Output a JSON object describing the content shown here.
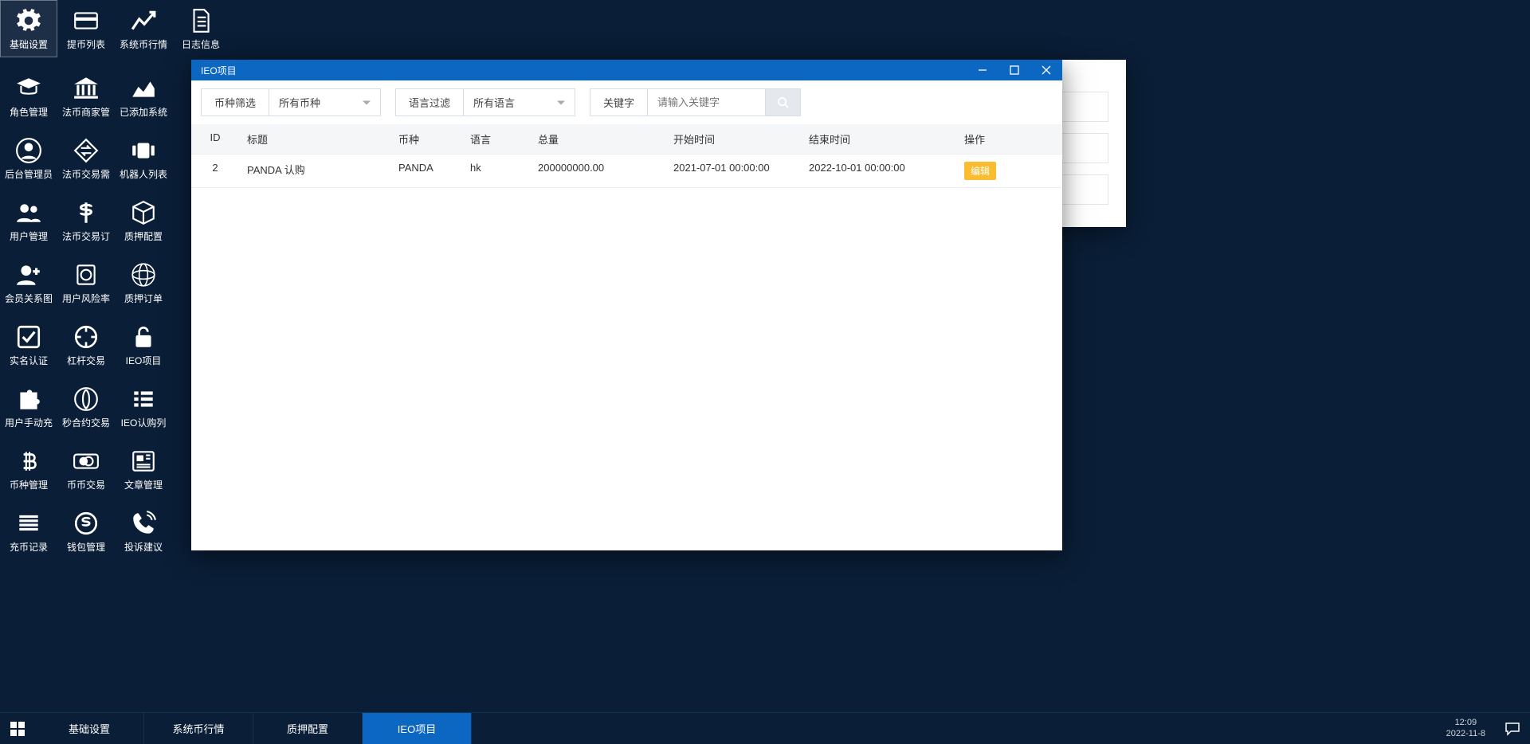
{
  "desktop_icons_top": [
    {
      "label": "基础设置",
      "icon": "gears",
      "selected": true
    },
    {
      "label": "提币列表",
      "icon": "card"
    },
    {
      "label": "系统币行情",
      "icon": "chart-line"
    },
    {
      "label": "日志信息",
      "icon": "file"
    }
  ],
  "desktop_icons_grid": [
    {
      "label": "角色管理",
      "icon": "grad"
    },
    {
      "label": "法币商家管",
      "icon": "bank"
    },
    {
      "label": "已添加系统",
      "icon": "area"
    },
    {
      "label": "后台管理员",
      "icon": "user-circ"
    },
    {
      "label": "法币交易需",
      "icon": "exchange"
    },
    {
      "label": "机器人列表",
      "icon": "carousel"
    },
    {
      "label": "用户管理",
      "icon": "users"
    },
    {
      "label": "法币交易订",
      "icon": "dollar"
    },
    {
      "label": "质押配置",
      "icon": "cube"
    },
    {
      "label": "会员关系图",
      "icon": "user-plus"
    },
    {
      "label": "用户风险率",
      "icon": "shield"
    },
    {
      "label": "质押订单",
      "icon": "sphere"
    },
    {
      "label": "实名认证",
      "icon": "check-sq"
    },
    {
      "label": "杠杆交易",
      "icon": "ring"
    },
    {
      "label": "IEO项目",
      "icon": "unlock"
    },
    {
      "label": "用户手动充",
      "icon": "puzzle"
    },
    {
      "label": "秒合约交易",
      "icon": "rebel"
    },
    {
      "label": "IEO认购列",
      "icon": "list"
    },
    {
      "label": "币种管理",
      "icon": "btc"
    },
    {
      "label": "币币交易",
      "icon": "mastercard"
    },
    {
      "label": "文章管理",
      "icon": "news"
    },
    {
      "label": "充币记录",
      "icon": "lines"
    },
    {
      "label": "钱包管理",
      "icon": "skype"
    },
    {
      "label": "投诉建议",
      "icon": "phone"
    }
  ],
  "window": {
    "title": "IEO项目",
    "filters": {
      "coin_label": "币种筛选",
      "coin_value": "所有币种",
      "lang_label": "语言过滤",
      "lang_value": "所有语言",
      "kw_label": "关键字",
      "kw_placeholder": "请输入关键字"
    },
    "columns": {
      "id": "ID",
      "title": "标题",
      "coin": "币种",
      "lang": "语言",
      "total": "总量",
      "start": "开始时间",
      "end": "结束时间",
      "op": "操作"
    },
    "rows": [
      {
        "id": "2",
        "title": "PANDA 认购",
        "coin": "PANDA",
        "lang": "hk",
        "total": "200000000.00",
        "start": "2021-07-01 00:00:00",
        "end": "2022-10-01 00:00:00",
        "op": "编辑"
      }
    ]
  },
  "taskbar": {
    "tabs": [
      {
        "label": "基础设置",
        "active": false
      },
      {
        "label": "系统币行情",
        "active": false
      },
      {
        "label": "质押配置",
        "active": false
      },
      {
        "label": "IEO项目",
        "active": true
      }
    ],
    "time": "12:09",
    "date": "2022-11-8"
  }
}
